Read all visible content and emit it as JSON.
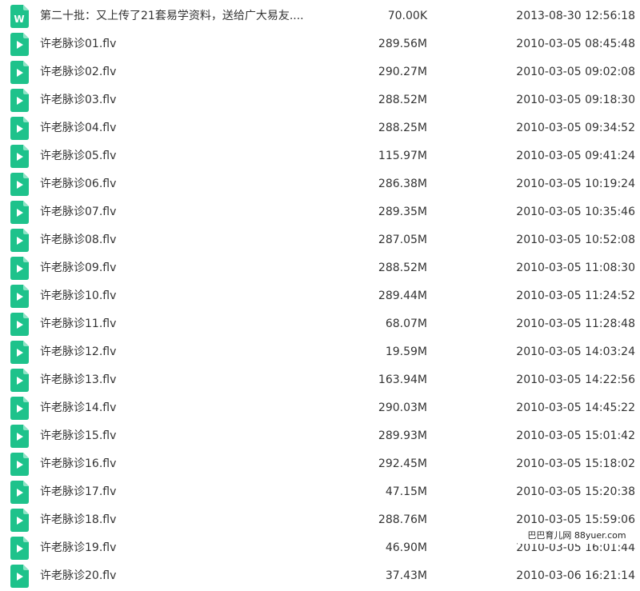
{
  "colors": {
    "icon_green": "#1ec28b",
    "text": "#333333"
  },
  "files": [
    {
      "icon": "word-doc-icon",
      "name": "第二十批：又上传了21套易学资料，送给广大易友....",
      "size": "70.00K",
      "date": "2013-08-30 12:56:18"
    },
    {
      "icon": "video-file-icon",
      "name": "许老脉诊01.flv",
      "size": "289.56M",
      "date": "2010-03-05 08:45:48"
    },
    {
      "icon": "video-file-icon",
      "name": "许老脉诊02.flv",
      "size": "290.27M",
      "date": "2010-03-05 09:02:08"
    },
    {
      "icon": "video-file-icon",
      "name": "许老脉诊03.flv",
      "size": "288.52M",
      "date": "2010-03-05 09:18:30"
    },
    {
      "icon": "video-file-icon",
      "name": "许老脉诊04.flv",
      "size": "288.25M",
      "date": "2010-03-05 09:34:52"
    },
    {
      "icon": "video-file-icon",
      "name": "许老脉诊05.flv",
      "size": "115.97M",
      "date": "2010-03-05 09:41:24"
    },
    {
      "icon": "video-file-icon",
      "name": "许老脉诊06.flv",
      "size": "286.38M",
      "date": "2010-03-05 10:19:24"
    },
    {
      "icon": "video-file-icon",
      "name": "许老脉诊07.flv",
      "size": "289.35M",
      "date": "2010-03-05 10:35:46"
    },
    {
      "icon": "video-file-icon",
      "name": "许老脉诊08.flv",
      "size": "287.05M",
      "date": "2010-03-05 10:52:08"
    },
    {
      "icon": "video-file-icon",
      "name": "许老脉诊09.flv",
      "size": "288.52M",
      "date": "2010-03-05 11:08:30"
    },
    {
      "icon": "video-file-icon",
      "name": "许老脉诊10.flv",
      "size": "289.44M",
      "date": "2010-03-05 11:24:52"
    },
    {
      "icon": "video-file-icon",
      "name": "许老脉诊11.flv",
      "size": "68.07M",
      "date": "2010-03-05 11:28:48"
    },
    {
      "icon": "video-file-icon",
      "name": "许老脉诊12.flv",
      "size": "19.59M",
      "date": "2010-03-05 14:03:24"
    },
    {
      "icon": "video-file-icon",
      "name": "许老脉诊13.flv",
      "size": "163.94M",
      "date": "2010-03-05 14:22:56"
    },
    {
      "icon": "video-file-icon",
      "name": "许老脉诊14.flv",
      "size": "290.03M",
      "date": "2010-03-05 14:45:22"
    },
    {
      "icon": "video-file-icon",
      "name": "许老脉诊15.flv",
      "size": "289.93M",
      "date": "2010-03-05 15:01:42"
    },
    {
      "icon": "video-file-icon",
      "name": "许老脉诊16.flv",
      "size": "292.45M",
      "date": "2010-03-05 15:18:02"
    },
    {
      "icon": "video-file-icon",
      "name": "许老脉诊17.flv",
      "size": "47.15M",
      "date": "2010-03-05 15:20:38"
    },
    {
      "icon": "video-file-icon",
      "name": "许老脉诊18.flv",
      "size": "288.76M",
      "date": "2010-03-05 15:59:06"
    },
    {
      "icon": "video-file-icon",
      "name": "许老脉诊19.flv",
      "size": "46.90M",
      "date": "2010-03-05 16:01:44"
    },
    {
      "icon": "video-file-icon",
      "name": "许老脉诊20.flv",
      "size": "37.43M",
      "date": "2010-03-06 16:21:14"
    }
  ],
  "watermark": {
    "text": "巴巴育儿网 88yuer.com"
  }
}
